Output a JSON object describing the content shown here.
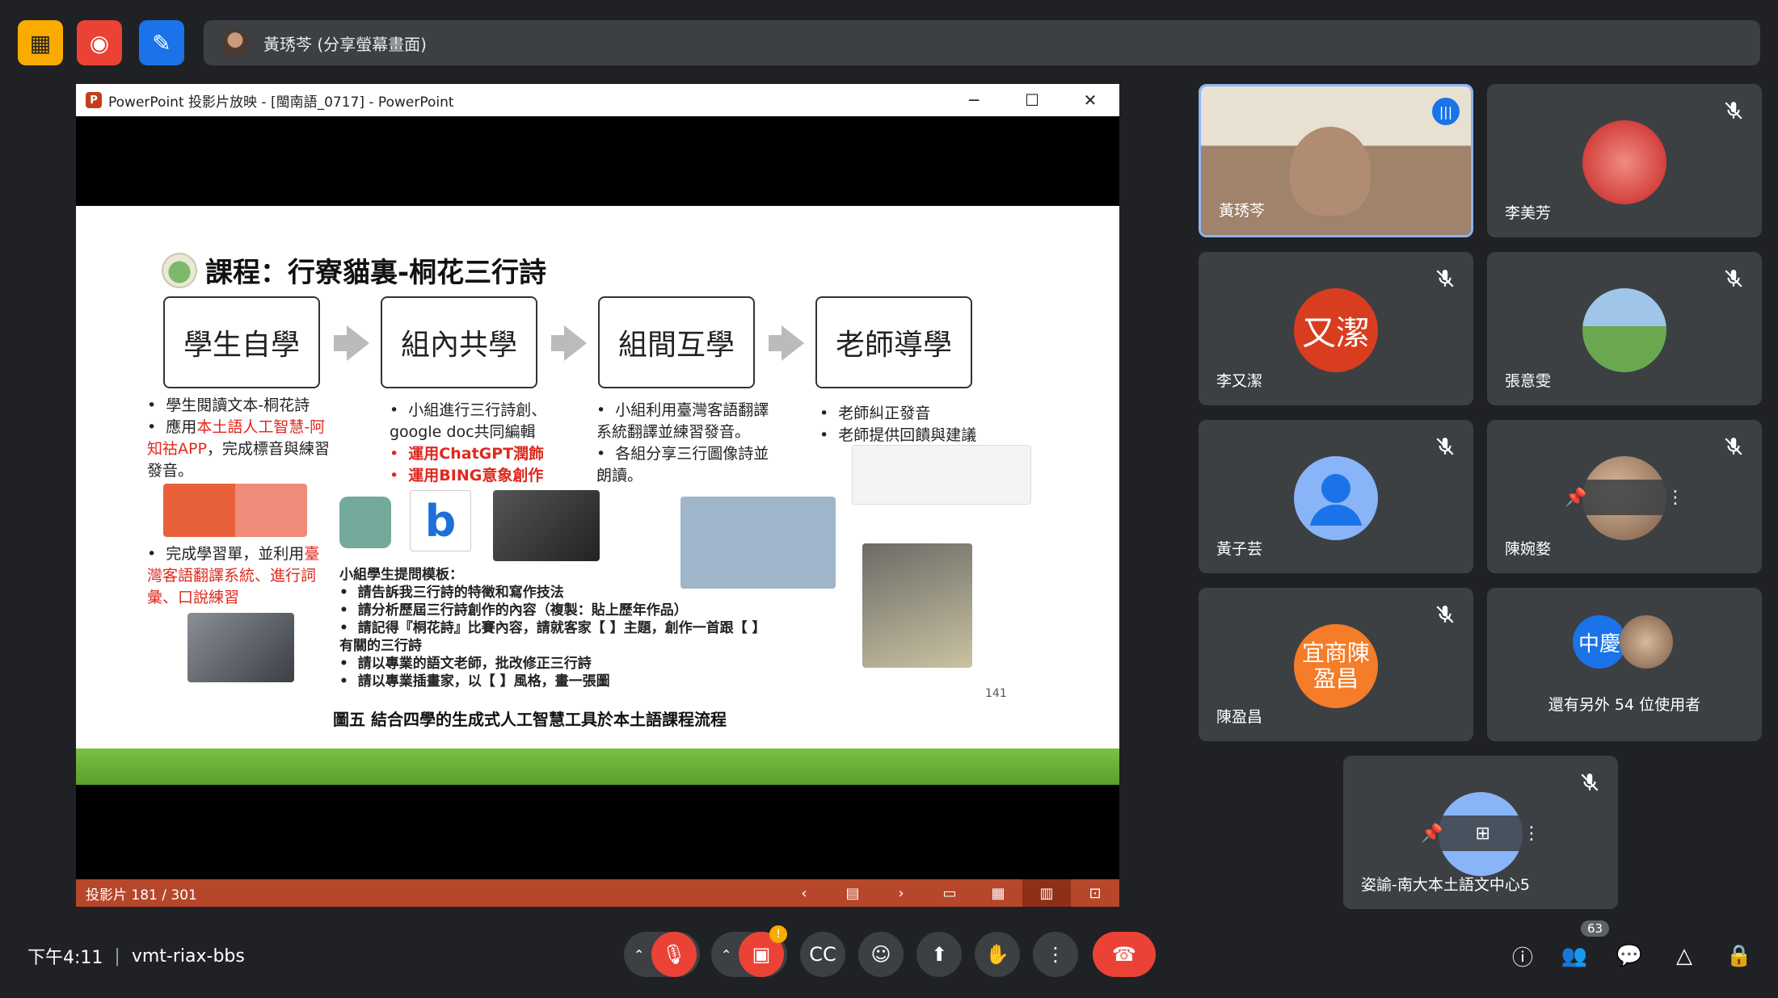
{
  "top_bar": {
    "share_label": "黃琇芩 (分享螢幕畫面)"
  },
  "ppt": {
    "title": "PowerPoint 投影片放映 - [閩南語_0717] - PowerPoint",
    "status": "投影片 181 / 301",
    "slide": {
      "title": "課程：行寮貓裏-桐花三行詩",
      "stages": [
        "學生自學",
        "組內共學",
        "組間互學",
        "老師導學"
      ],
      "col1": {
        "b1": "學生閱讀文本-桐花詩",
        "b2_pre": "應用",
        "b2_red": "本土語人工智慧-阿知祜APP",
        "b2_post": "，完成標音與練習發音。",
        "b3_pre": "完成學習單，並利用",
        "b3_red": "臺灣客語翻譯系統、進行詞彙、口說練習"
      },
      "col2": {
        "b1": "小組進行三行詩創、google doc共同編輯",
        "b2": "運用ChatGPT潤飾",
        "b3": "運用BING意象創作"
      },
      "col3": {
        "b1": "小組利用臺灣客語翻譯系統翻譯並練習發音。",
        "b2": "各組分享三行圖像詩並朗讀。"
      },
      "col4": {
        "b1": "老師糾正發音",
        "b2": "老師提供回饋與建議"
      },
      "prompt_title": "小組學生提問模板：",
      "prompts": [
        "請告訴我三行詩的特徵和寫作技法",
        "請分析歷屆三行詩創作的內容（複製：貼上歷年作品）",
        "請記得『桐花詩』比賽內容，請就客家【 】主題，創作一首跟【 】有關的三行詩",
        "請以專業的語文老師，批改修正三行詩",
        "請以專業插畫家，以【 】風格，畫一張圖"
      ],
      "page_number": "141",
      "caption": "圖五 結合四學的生成式人工智慧工具於本土語課程流程"
    }
  },
  "participants": [
    {
      "name": "黃琇芩",
      "type": "video"
    },
    {
      "name": "李美芳",
      "type": "avatar"
    },
    {
      "name": "李又潔",
      "type": "initials",
      "initials": "又潔",
      "color": "#d93d1f"
    },
    {
      "name": "張意雯",
      "type": "avatar"
    },
    {
      "name": "黃子芸",
      "type": "default"
    },
    {
      "name": "陳婉婺",
      "type": "avatar"
    },
    {
      "name": "陳盈昌",
      "type": "initials",
      "initials": "宜商陳盈昌",
      "color": "#f57c28"
    },
    {
      "name": "還有另外 54 位使用者",
      "type": "overflow",
      "initials": "中慶"
    },
    {
      "name": "姿諭-南大本土語文中心5",
      "type": "self"
    }
  ],
  "bottom": {
    "time": "下午4:11",
    "meeting_code": "vmt-riax-bbs",
    "participant_count": "63"
  }
}
